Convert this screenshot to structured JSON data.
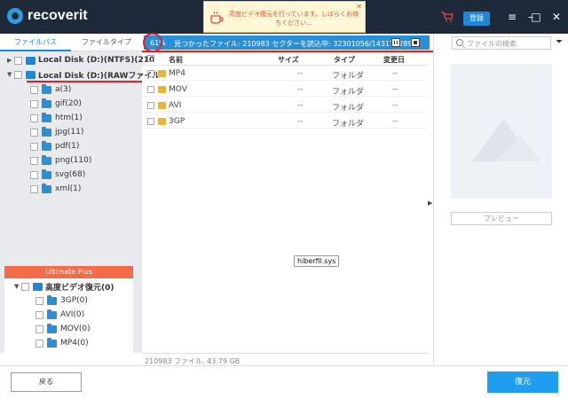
{
  "app": {
    "name": "recoverit",
    "register_label": "登録"
  },
  "toast": {
    "message": "高度ビデオ復元を行っています。しばらくお待ちください..."
  },
  "tabs": {
    "file_path": "ファイルパス",
    "file_type": "ファイルタイプ"
  },
  "tree": {
    "drive1": "Local Disk (D:)(NTFS)(210",
    "drive2": "Local Disk (D:)(RAWファイル",
    "folders": [
      "a(3)",
      "gif(20)",
      "htm(1)",
      "jpg(11)",
      "pdf(1)",
      "png(110)",
      "svg(68)",
      "xml(1)"
    ]
  },
  "ultimate": {
    "header": "Ultimate Plus",
    "root": "高度ビデオ復元(0)",
    "items": [
      "3GP(0)",
      "AVI(0)",
      "MOV(0)",
      "MP4(0)"
    ]
  },
  "status": {
    "percent": "61%",
    "text": "見つかったファイル: 210983  セクターを読込中: 32301056/143171289"
  },
  "table": {
    "columns": {
      "name": "名前",
      "size": "サイズ",
      "type": "タイプ",
      "date": "変更日"
    },
    "rows": [
      {
        "name": "MP4",
        "size": "--",
        "type": "フォルダ",
        "date": "--"
      },
      {
        "name": "MOV",
        "size": "--",
        "type": "フォルダ",
        "date": "--"
      },
      {
        "name": "AVI",
        "size": "--",
        "type": "フォルダ",
        "date": "--"
      },
      {
        "name": "3GP",
        "size": "--",
        "type": "フォルダ",
        "date": "--"
      }
    ]
  },
  "tooltip": "hiberfil.sys",
  "footer": "210983 ファイル, 43.79 GB",
  "search": {
    "placeholder": "ファイルの検索"
  },
  "preview_label": "プレビュー",
  "buttons": {
    "back": "戻る",
    "recover": "復元"
  },
  "colors": {
    "accent": "#1f87d6",
    "title_bar": "#1e2a3a",
    "highlight": "#e02020",
    "ultimate": "#f56b4a"
  }
}
